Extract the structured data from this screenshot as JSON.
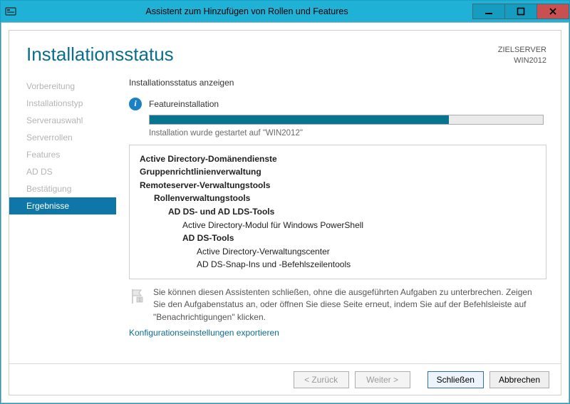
{
  "window": {
    "title": "Assistent zum Hinzufügen von Rollen und Features"
  },
  "header": {
    "page_title": "Installationsstatus",
    "target_label": "ZIELSERVER",
    "target_value": "WIN2012"
  },
  "nav": {
    "items": [
      {
        "label": "Vorbereitung",
        "active": false
      },
      {
        "label": "Installationstyp",
        "active": false
      },
      {
        "label": "Serverauswahl",
        "active": false
      },
      {
        "label": "Serverrollen",
        "active": false
      },
      {
        "label": "Features",
        "active": false
      },
      {
        "label": "AD DS",
        "active": false
      },
      {
        "label": "Bestätigung",
        "active": false
      },
      {
        "label": "Ergebnisse",
        "active": true
      }
    ]
  },
  "content": {
    "status_label": "Installationsstatus anzeigen",
    "feature_label": "Featureinstallation",
    "progress_percent": 76,
    "progress_text": "Installation wurde gestartet auf \"WIN2012\"",
    "tree": [
      {
        "text": "Active Directory-Domänendienste",
        "level": 0,
        "bold": true
      },
      {
        "text": "Gruppenrichtlinienverwaltung",
        "level": 0,
        "bold": true
      },
      {
        "text": "Remoteserver-Verwaltungstools",
        "level": 0,
        "bold": true
      },
      {
        "text": "Rollenverwaltungstools",
        "level": 1,
        "bold": true
      },
      {
        "text": "AD DS- und AD LDS-Tools",
        "level": 2,
        "bold": true
      },
      {
        "text": "Active Directory-Modul für Windows PowerShell",
        "level": 3,
        "bold": false
      },
      {
        "text": "AD DS-Tools",
        "level": 3,
        "bold": true
      },
      {
        "text": "Active Directory-Verwaltungscenter",
        "level": 4,
        "bold": false
      },
      {
        "text": "AD DS-Snap-Ins und -Befehlszeilentools",
        "level": 4,
        "bold": false
      }
    ],
    "note": "Sie können diesen Assistenten schließen, ohne die ausgeführten Aufgaben zu unterbrechen. Zeigen Sie den Aufgabenstatus an, oder öffnen Sie diese Seite erneut, indem Sie auf der Befehlsleiste auf \"Benachrichtigungen\" klicken.",
    "export_link": "Konfigurationseinstellungen exportieren"
  },
  "footer": {
    "back": "< Zurück",
    "next": "Weiter >",
    "close": "Schließen",
    "cancel": "Abbrechen"
  },
  "colors": {
    "accent": "#1fb1d6",
    "accent_dark": "#0f77a8",
    "progress_fill": "#07758f"
  }
}
